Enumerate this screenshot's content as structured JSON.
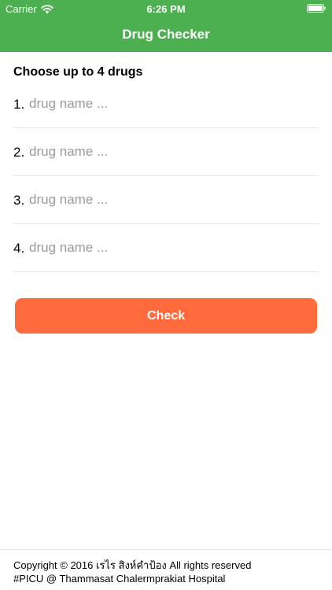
{
  "status_bar": {
    "carrier": "Carrier",
    "time": "6:26 PM"
  },
  "nav": {
    "title": "Drug Checker"
  },
  "form": {
    "heading": "Choose up to 4 drugs",
    "drugs": [
      {
        "number": "1.",
        "placeholder": "drug name ...",
        "value": ""
      },
      {
        "number": "2.",
        "placeholder": "drug name ...",
        "value": ""
      },
      {
        "number": "3.",
        "placeholder": "drug name ...",
        "value": ""
      },
      {
        "number": "4.",
        "placeholder": "drug name ...",
        "value": ""
      }
    ],
    "check_label": "Check"
  },
  "footer": {
    "line1": "Copyright © 2016 เรไร สิงห์คำป้อง All rights reserved",
    "line2": "#PICU @ Thammasat Chalermprakiat Hospital"
  },
  "colors": {
    "nav_bg": "#4CAF50",
    "button_bg": "#FF6B3D",
    "placeholder": "#9a9a9a",
    "divider": "#e6e6e6"
  },
  "icons": {
    "wifi": "wifi-icon",
    "battery": "battery-icon"
  }
}
